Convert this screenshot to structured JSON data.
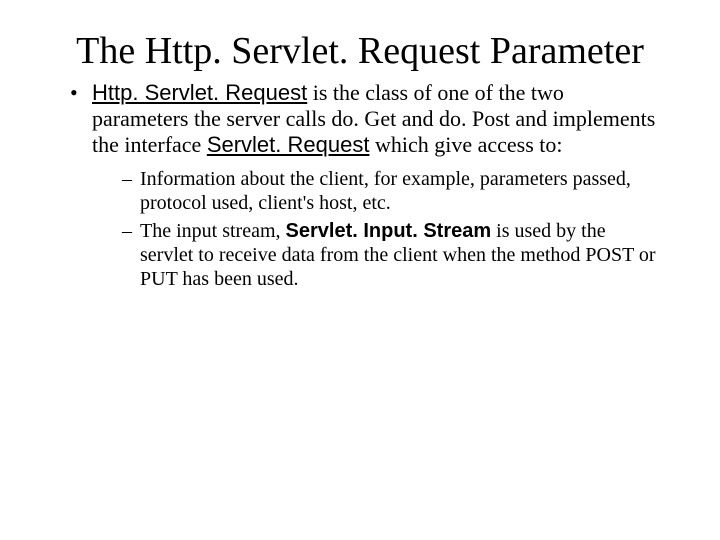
{
  "title": "The Http. Servlet. Request Parameter",
  "bullet1": {
    "lead": "Http. Servlet. Request",
    "mid1": " is the class of one of the two parameters the server calls do. Get and do. Post and implements the interface ",
    "iface": "Servlet. Request",
    "mid2": " which give access to:"
  },
  "sub1": "Information about the client, for example, parameters passed, protocol used, client's host, etc.",
  "sub2": {
    "pre": "The input stream, ",
    "stream": "Servlet. Input. Stream",
    "post": " is used by the servlet to receive data from the client when the method POST or PUT has been used."
  }
}
